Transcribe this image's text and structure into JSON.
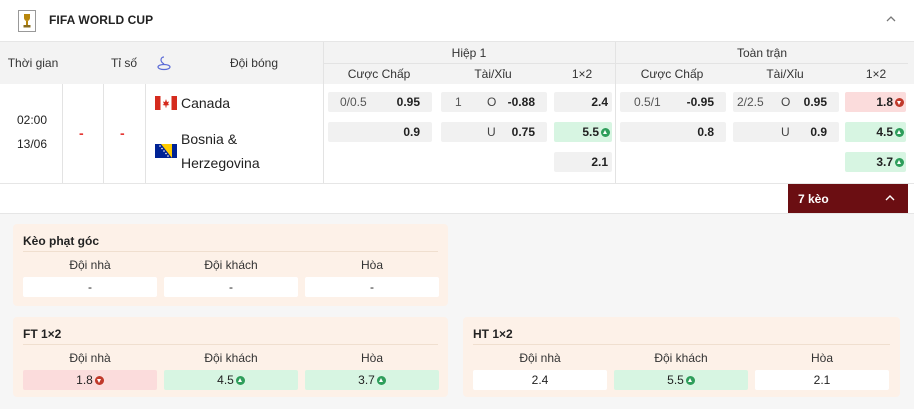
{
  "header": {
    "title": "FIFA WORLD CUP"
  },
  "table_header": {
    "time": "Thời gian",
    "score": "Tỉ số",
    "team": "Đội bóng",
    "half": "Hiệp 1",
    "full": "Toàn trận",
    "handicap": "Cược Chấp",
    "over_under": "Tài/Xỉu",
    "one_x_two": "1×2"
  },
  "match": {
    "time": "02:00",
    "date": "13/06",
    "score_home": "-",
    "score_away": "-",
    "home": "Canada",
    "away_line1": "Bosnia &",
    "away_line2": "Herzegovina",
    "half": {
      "hdp_line": "0/0.5",
      "hdp_home": "0.95",
      "hdp_away": "0.9",
      "ou_line": "1",
      "ou_o_label": "O",
      "ou_over": "-0.88",
      "ou_u_label": "U",
      "ou_under": "0.75",
      "x12_home": "2.4",
      "x12_away": "5.5",
      "x12_draw": "2.1"
    },
    "full": {
      "hdp_line": "0.5/1",
      "hdp_home": "-0.95",
      "hdp_away": "0.8",
      "ou_line": "2/2.5",
      "ou_o_label": "O",
      "ou_over": "0.95",
      "ou_u_label": "U",
      "ou_under": "0.9",
      "x12_home": "1.8",
      "x12_away": "4.5",
      "x12_draw": "3.7"
    }
  },
  "more_button": {
    "label": "7 kèo"
  },
  "corner_panel": {
    "title": "Kèo phạt góc",
    "labels": [
      "Đội nhà",
      "Đội khách",
      "Hòa"
    ],
    "values": [
      "-",
      "-",
      "-"
    ]
  },
  "ft_panel": {
    "title": "FT 1×2",
    "labels": [
      "Đội nhà",
      "Đội khách",
      "Hòa"
    ],
    "values": [
      "1.8",
      "4.5",
      "3.7"
    ]
  },
  "ht_panel": {
    "title": "HT 1×2",
    "labels": [
      "Đội nhà",
      "Đội khách",
      "Hòa"
    ],
    "values": [
      "2.4",
      "5.5",
      "2.1"
    ]
  },
  "colors": {
    "brand_dark_red": "#6b0e12",
    "score_dash": "#e53935",
    "up_bg": "#d7f5e2",
    "down_bg": "#fbdcdc",
    "panel_bg": "#fdf1e8"
  }
}
